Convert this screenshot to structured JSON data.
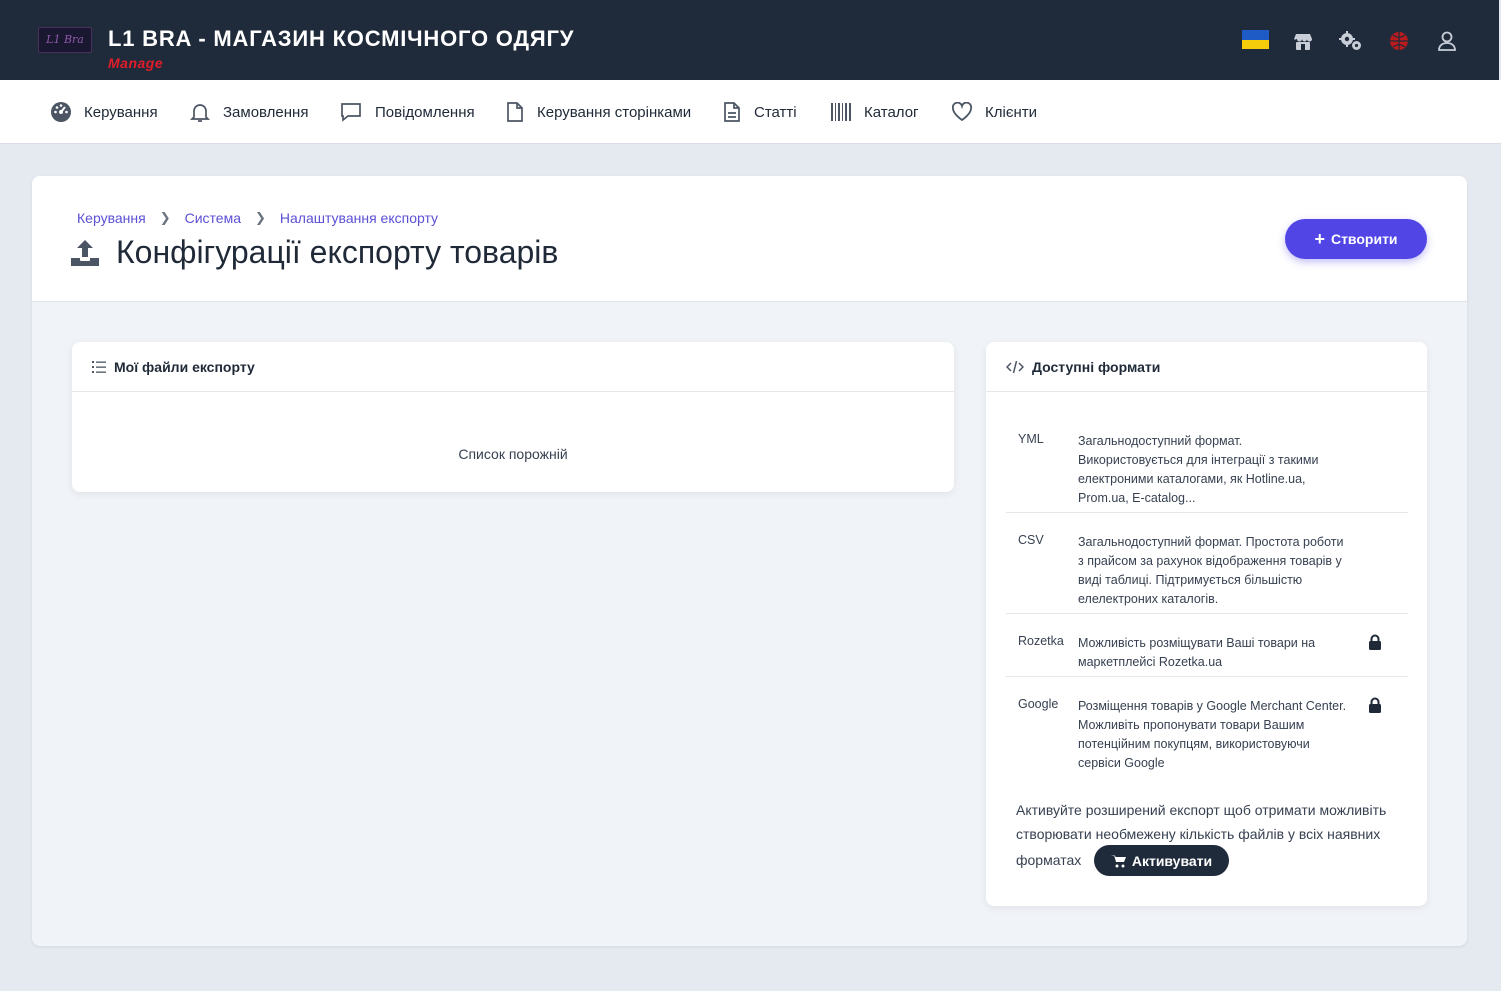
{
  "header": {
    "logo_text": "L1 Bra",
    "store_title": "L1 BRA - МАГАЗИН КОСМІЧНОГО ОДЯГУ",
    "subtitle": "Manage",
    "icons": [
      "ukraine-flag",
      "store-icon",
      "settings-icon",
      "globe-icon",
      "user-icon"
    ]
  },
  "nav": {
    "items": [
      {
        "label": "Керування",
        "icon": "dashboard-icon"
      },
      {
        "label": "Замовлення",
        "icon": "bell-icon"
      },
      {
        "label": "Повідомлення",
        "icon": "message-icon"
      },
      {
        "label": "Керування сторінками",
        "icon": "page-icon"
      },
      {
        "label": "Статті",
        "icon": "document-icon"
      },
      {
        "label": "Каталог",
        "icon": "barcode-icon"
      },
      {
        "label": "Клієнти",
        "icon": "heart-icon"
      }
    ]
  },
  "breadcrumb": [
    "Керування",
    "Система",
    "Налаштування експорту"
  ],
  "page_title": "Конфігурації експорту товарів",
  "create_button": "Створити",
  "my_files": {
    "title": "Мої файли експорту",
    "empty_text": "Список порожній"
  },
  "formats": {
    "title": "Доступні формати",
    "items": [
      {
        "name": "YML",
        "description": "Загальнодоступний формат. Використовується для інтеграції з такими електроними каталогами, як Hotline.ua, Prom.ua, E-catalog...",
        "locked": false
      },
      {
        "name": "CSV",
        "description": "Загальнодоступний формат. Простота роботи з прайсом за рахунок відображення товарів у виді таблиці. Підтримується більшістю елелектроних каталогів.",
        "locked": false
      },
      {
        "name": "Rozetka",
        "description": "Можливість розміщувати Ваші товари на маркетплейсі Rozetka.ua",
        "locked": true
      },
      {
        "name": "Google",
        "description": "Розміщення товарів у Google Merchant Center. Можливіть пропонувати товари Вашим потенційним покупцям, використовуючи сервіси Google",
        "locked": true
      }
    ],
    "promo_text": "Активуйте розширений експорт щоб отримати можливіть створювати необмежену кількість файлів у всіх наявних",
    "promo_last_word": "форматах",
    "activate_button": "Активувати"
  }
}
